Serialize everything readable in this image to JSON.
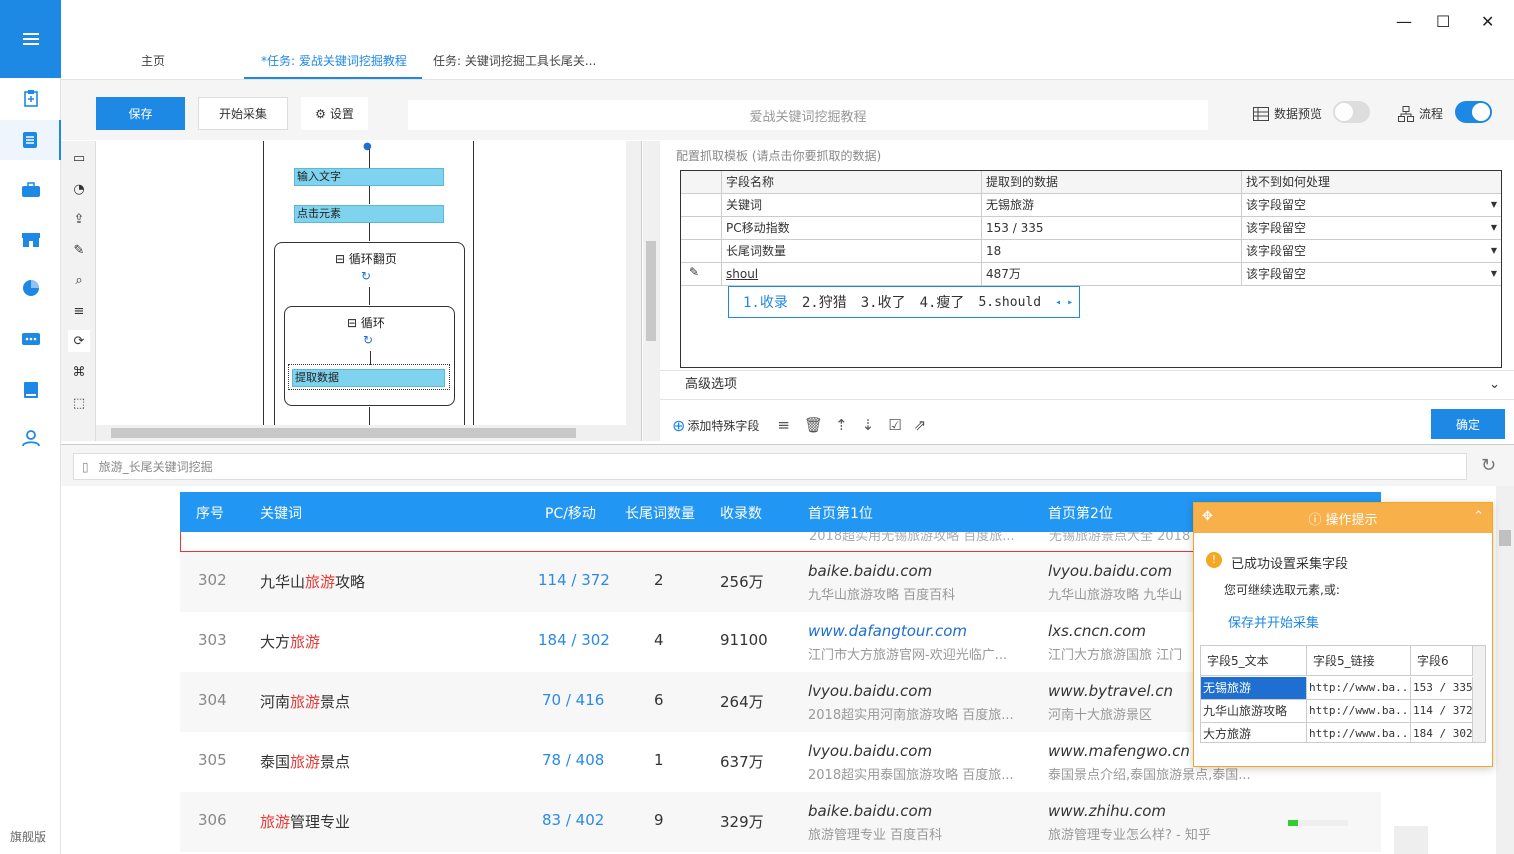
{
  "app": {
    "edition": "旗舰版"
  },
  "tabs": [
    {
      "label": "主页"
    },
    {
      "label": "*任务: 爱战关键词挖掘教程"
    },
    {
      "label": "任务: 关键词挖掘工具长尾关..."
    }
  ],
  "window": {
    "minimize": "—",
    "maximize": "☐",
    "close": "✕"
  },
  "toolbar": {
    "save_label": "保存",
    "start_label": "开始采集",
    "settings_label": "设置",
    "task_name": "爱战关键词挖掘教程",
    "preview_label": "数据预览",
    "flow_label": "流程",
    "preview_on": false,
    "flow_on": true
  },
  "workflow": {
    "steps": [
      "输入文字",
      "点击元素",
      "提取数据"
    ],
    "loop_page_label": "循环翻页",
    "loop_label": "循环"
  },
  "config": {
    "title": "配置抓取模板 (请点击你要抓取的数据)",
    "columns": [
      "字段名称",
      "提取到的数据",
      "找不到如何处理"
    ],
    "rows": [
      {
        "name": "关键词",
        "value": "无锡旅游",
        "action": "该字段留空"
      },
      {
        "name": "PC移动指数",
        "value": "153 / 335",
        "action": "该字段留空"
      },
      {
        "name": "长尾词数量",
        "value": "18",
        "action": "该字段留空"
      },
      {
        "name": "shoul",
        "value": "487万",
        "action": "该字段留空"
      }
    ],
    "ime_candidates": [
      "1.收录",
      "2.狩猎",
      "3.收了",
      "4.瘦了",
      "5.should"
    ],
    "advanced_label": "高级选项",
    "add_field_label": "添加特殊字段",
    "ok_label": "确定"
  },
  "address": {
    "value": "旅游_长尾关键词挖掘"
  },
  "results": {
    "headers": [
      "序号",
      "关键词",
      "PC/移动",
      "长尾词数量",
      "收录数",
      "首页第1位",
      "首页第2位"
    ],
    "partial_row": {
      "first": "2018超实用无锡旅游攻略 百度旅...",
      "second": "无锡旅游景点大全 2018"
    },
    "rows": [
      {
        "id": "302",
        "kw_pre": "九华山",
        "kw_hl": "旅游",
        "kw_post": "攻略",
        "pcm": "114 / 372",
        "long": "2",
        "idx": "256万",
        "u1": "baike.baidu.com",
        "d1": "九华山旅游攻略 百度百科",
        "u2": "lvyou.baidu.com",
        "d2": "九华山旅游攻略 九华山"
      },
      {
        "id": "303",
        "kw_pre": "大方",
        "kw_hl": "旅游",
        "kw_post": "",
        "pcm": "184 / 302",
        "long": "4",
        "idx": "91100",
        "u1": "www.dafangtour.com",
        "d1": "江门市大方旅游官网-欢迎光临广...",
        "u2": "lxs.cncn.com",
        "d2": "江门大方旅游国旅 江门"
      },
      {
        "id": "304",
        "kw_pre": "河南",
        "kw_hl": "旅游",
        "kw_post": "景点",
        "pcm": "70 / 416",
        "long": "6",
        "idx": "264万",
        "u1": "lvyou.baidu.com",
        "d1": "2018超实用河南旅游攻略 百度旅...",
        "u2": "www.bytravel.cn",
        "d2": "河南十大旅游景区"
      },
      {
        "id": "305",
        "kw_pre": "泰国",
        "kw_hl": "旅游",
        "kw_post": "景点",
        "pcm": "78 / 408",
        "long": "1",
        "idx": "637万",
        "u1": "lvyou.baidu.com",
        "d1": "2018超实用泰国旅游攻略 百度旅...",
        "u2": "www.mafengwo.cn",
        "d2": "泰国景点介绍,泰国旅游景点,泰国..."
      },
      {
        "id": "306",
        "kw_pre": "",
        "kw_hl": "旅游",
        "kw_post": "管理专业",
        "pcm": "83 / 402",
        "long": "9",
        "idx": "329万",
        "u1": "baike.baidu.com",
        "d1": "旅游管理专业 百度百科",
        "u2": "www.zhihu.com",
        "d2": "旅游管理专业怎么样? - 知乎"
      }
    ]
  },
  "popup": {
    "title": "操作提示",
    "success": "已成功设置采集字段",
    "hint": "您可继续选取元素,或:",
    "link": "保存并开始采集",
    "grid_headers": [
      "字段5_文本",
      "字段5_链接",
      "字段6"
    ],
    "grid_rows": [
      [
        "无锡旅游",
        "http://www.ba...",
        "153 / 335"
      ],
      [
        "九华山旅游攻略",
        "http://www.ba...",
        "114 / 372"
      ],
      [
        "大方旅游",
        "http://www.ba...",
        "184 / 302"
      ]
    ]
  },
  "colors": {
    "accent": "#1e88e5",
    "highlight": "#e53935",
    "popup": "#f7b04a"
  }
}
